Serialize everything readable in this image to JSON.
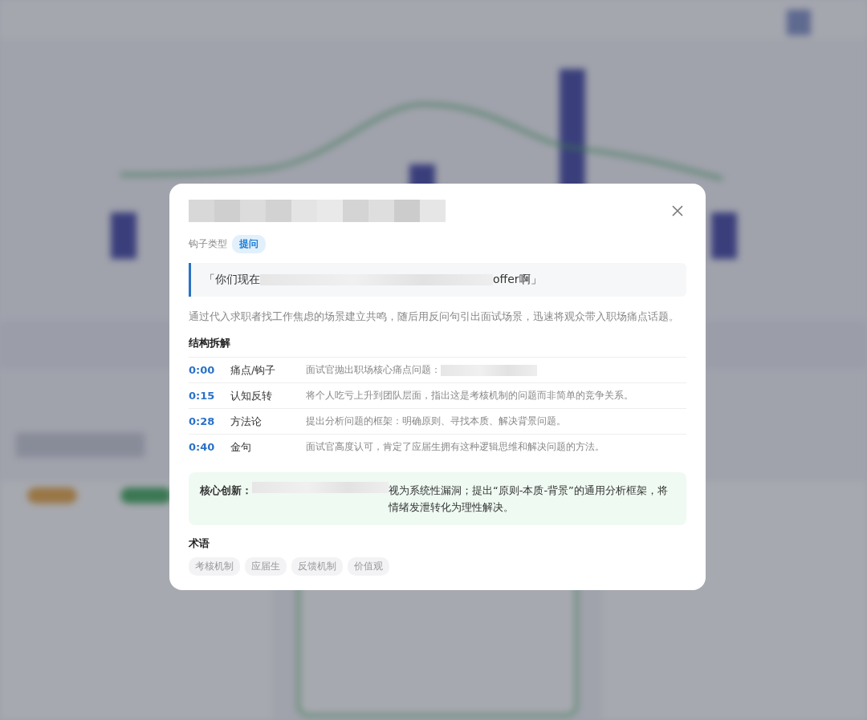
{
  "dialog": {
    "title_redacted": true,
    "hook": {
      "label": "钩子类型",
      "type": "提问"
    },
    "quote": {
      "before": "「你们现在",
      "redacted": true,
      "after": "offer啊」"
    },
    "summary": "通过代入求职者找工作焦虑的场景建立共鸣，随后用反问句引出面试场景，迅速将观众带入职场痛点话题。",
    "structure": {
      "heading": "结构拆解",
      "rows": [
        {
          "time": "0:00",
          "phase": "痛点/钩子",
          "description": "面试官抛出职场核心痛点问题：",
          "redacted": true
        },
        {
          "time": "0:15",
          "phase": "认知反转",
          "description": "将个人吃亏上升到团队层面，指出这是考核机制的问题而非简单的竞争关系。",
          "redacted": false
        },
        {
          "time": "0:28",
          "phase": "方法论",
          "description": "提出分析问题的框架：明确原则、寻找本质、解决背景问题。",
          "redacted": false
        },
        {
          "time": "0:40",
          "phase": "金句",
          "description": "面试官高度认可，肯定了应届生拥有这种逻辑思维和解决问题的方法。",
          "redacted": false
        }
      ]
    },
    "innovation": {
      "label": "核心创新：",
      "redacted": true,
      "text": "视为系统性漏洞；提出“原则-本质-背景”的通用分析框架，将情绪发泄转化为理性解决。"
    },
    "terms": {
      "heading": "术语",
      "tags": [
        "考核机制",
        "应届生",
        "反馈机制",
        "价值观"
      ]
    }
  }
}
